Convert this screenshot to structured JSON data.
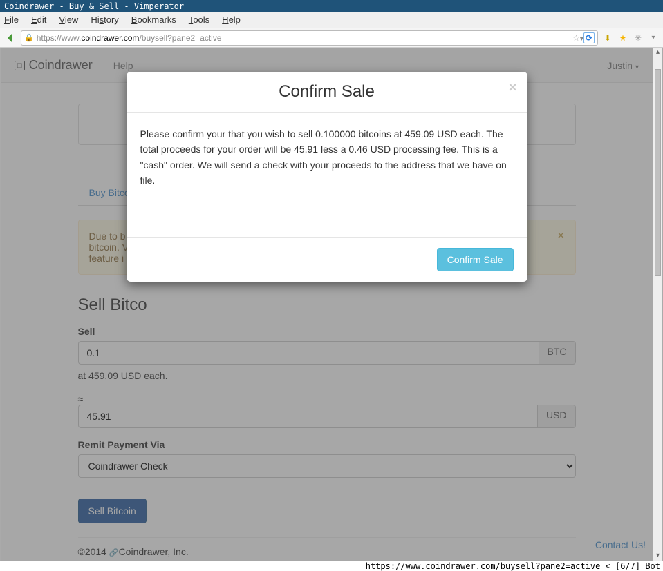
{
  "window": {
    "title": "Coindrawer - Buy & Sell - Vimperator"
  },
  "menu": {
    "file": "File",
    "edit": "Edit",
    "view": "View",
    "history": "History",
    "bookmarks": "Bookmarks",
    "tools": "Tools",
    "help": "Help"
  },
  "url": {
    "prefix": "https://www.",
    "domain": "coindrawer.com",
    "path": "/buysell?pane2=active"
  },
  "navbar": {
    "brand": "Coindrawer",
    "help": "Help",
    "user": "Justin"
  },
  "tabs": {
    "buy": "Buy Bitco"
  },
  "alert": {
    "line1": "Due to b",
    "line2": "bitcoin. V",
    "line3": "feature i"
  },
  "form": {
    "section_title": "Sell Bitco",
    "sell_label": "Sell",
    "sell_value": "0.1",
    "sell_unit": "BTC",
    "rate_text": "at 459.09 USD each.",
    "approx_label": "≈",
    "approx_value": "45.91",
    "approx_unit": "USD",
    "remit_label": "Remit Payment Via",
    "remit_value": "Coindrawer Check",
    "submit": "Sell Bitcoin"
  },
  "footer": {
    "copyright": "©2014 ",
    "company": "Coindrawer, Inc.",
    "contact": "Contact Us!"
  },
  "modal": {
    "title": "Confirm Sale",
    "body": "Please confirm your that you wish to sell 0.100000 bitcoins at 459.09 USD each. The total proceeds for your order will be 45.91 less a 0.46 USD processing fee. This is a \"cash\" order. We will send a check with your proceeds to the address that we have on file.",
    "confirm": "Confirm Sale"
  },
  "statusline": "https://www.coindrawer.com/buysell?pane2=active < [6/7] Bot"
}
